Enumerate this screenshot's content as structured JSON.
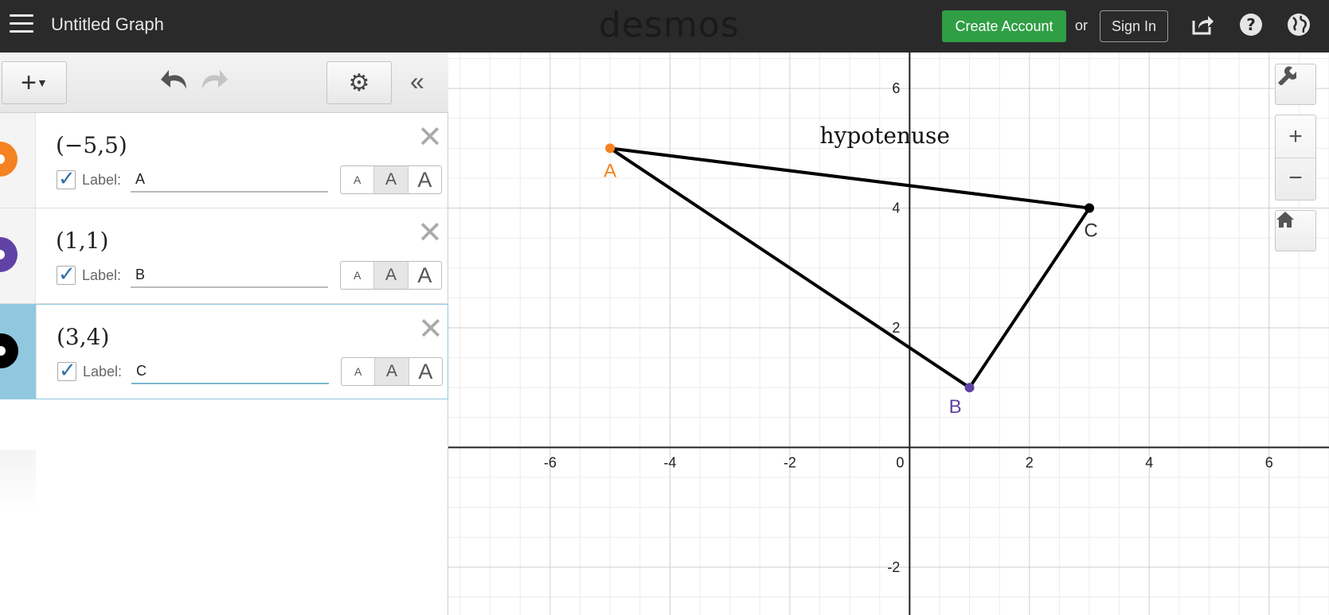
{
  "header": {
    "title": "Untitled Graph",
    "logo": "desmos",
    "create_account": "Create Account",
    "or": "or",
    "sign_in": "Sign In",
    "icons": [
      "share-icon",
      "help-icon",
      "globe-icon"
    ]
  },
  "toolbar": {
    "add": "+",
    "icons": [
      "undo-icon",
      "redo-icon",
      "gear-icon",
      "collapse-icon"
    ]
  },
  "expressions": [
    {
      "math": "(−5,5)",
      "label_text": "Label:",
      "label_value": "A",
      "color": "#f58220",
      "sizes": [
        "A",
        "A",
        "A"
      ]
    },
    {
      "math": "(1,1)",
      "label_text": "Label:",
      "label_value": "B",
      "color": "#6042a6",
      "sizes": [
        "A",
        "A",
        "A"
      ]
    },
    {
      "math": "(3,4)",
      "label_text": "Label:",
      "label_value": "C",
      "color": "#000000",
      "sizes": [
        "A",
        "A",
        "A"
      ]
    }
  ],
  "graph": {
    "annotation": "hypotenuse",
    "x_ticks": [
      "-6",
      "-4",
      "-2",
      "0",
      "2",
      "4",
      "6"
    ],
    "y_ticks": [
      "6",
      "4",
      "2",
      "-2"
    ],
    "points": [
      {
        "label": "A",
        "x": -5,
        "y": 5,
        "color": "#f58220"
      },
      {
        "label": "B",
        "x": 1,
        "y": 1,
        "color": "#6042a6"
      },
      {
        "label": "C",
        "x": 3,
        "y": 4,
        "color": "#000000"
      }
    ],
    "segments": [
      [
        "A",
        "C"
      ],
      [
        "A",
        "B"
      ],
      [
        "B",
        "C"
      ]
    ],
    "x_range": [
      -7.7,
      7.0
    ],
    "y_range": [
      -2.8,
      6.6
    ],
    "side_icons": [
      "wrench-icon",
      "zoom-in-icon",
      "zoom-out-icon",
      "home-icon"
    ]
  }
}
